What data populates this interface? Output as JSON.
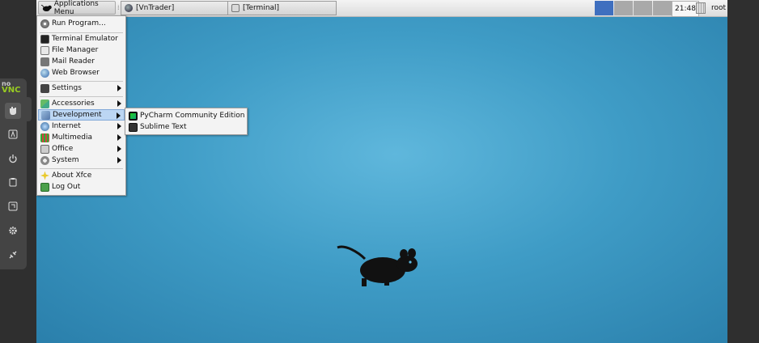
{
  "panel": {
    "app_menu_label": "Applications Menu",
    "tasks": [
      {
        "label": "[VnTrader]",
        "icon": "vntrader-icon"
      },
      {
        "label": "[Terminal]",
        "icon": "terminal-icon"
      }
    ],
    "workspaces": 4,
    "active_workspace": 1,
    "clock": "21:48",
    "user": "root"
  },
  "main_menu": {
    "items": [
      {
        "label": "Run Program...",
        "icon": "run-icon"
      },
      {
        "label": "Terminal Emulator",
        "icon": "terminal-icon"
      },
      {
        "label": "File Manager",
        "icon": "file-manager-icon"
      },
      {
        "label": "Mail Reader",
        "icon": "mail-icon"
      },
      {
        "label": "Web Browser",
        "icon": "web-browser-icon"
      },
      {
        "label": "Settings",
        "icon": "settings-icon",
        "submenu": true
      },
      {
        "label": "Accessories",
        "icon": "accessories-icon",
        "submenu": true
      },
      {
        "label": "Development",
        "icon": "development-icon",
        "submenu": true,
        "highlighted": true
      },
      {
        "label": "Internet",
        "icon": "internet-icon",
        "submenu": true
      },
      {
        "label": "Multimedia",
        "icon": "multimedia-icon",
        "submenu": true
      },
      {
        "label": "Office",
        "icon": "office-icon",
        "submenu": true
      },
      {
        "label": "System",
        "icon": "system-icon",
        "submenu": true
      },
      {
        "label": "About Xfce",
        "icon": "about-icon"
      },
      {
        "label": "Log Out",
        "icon": "logout-icon"
      }
    ]
  },
  "development_submenu": {
    "items": [
      {
        "label": "PyCharm Community Edition",
        "icon": "pycharm-icon"
      },
      {
        "label": "Sublime Text",
        "icon": "sublime-text-icon"
      }
    ]
  },
  "vnc_sidebar": {
    "logo_top": "no",
    "logo_bottom": "VNC",
    "buttons": [
      "drag-icon",
      "keyboard-icon",
      "power-icon",
      "clipboard-icon",
      "fullscreen-icon",
      "settings-icon",
      "disconnect-icon"
    ]
  },
  "colors": {
    "desktop": "#3f9cc6",
    "menu_highlight": "#bcd6f3",
    "active_workspace": "#3f6fbf"
  }
}
